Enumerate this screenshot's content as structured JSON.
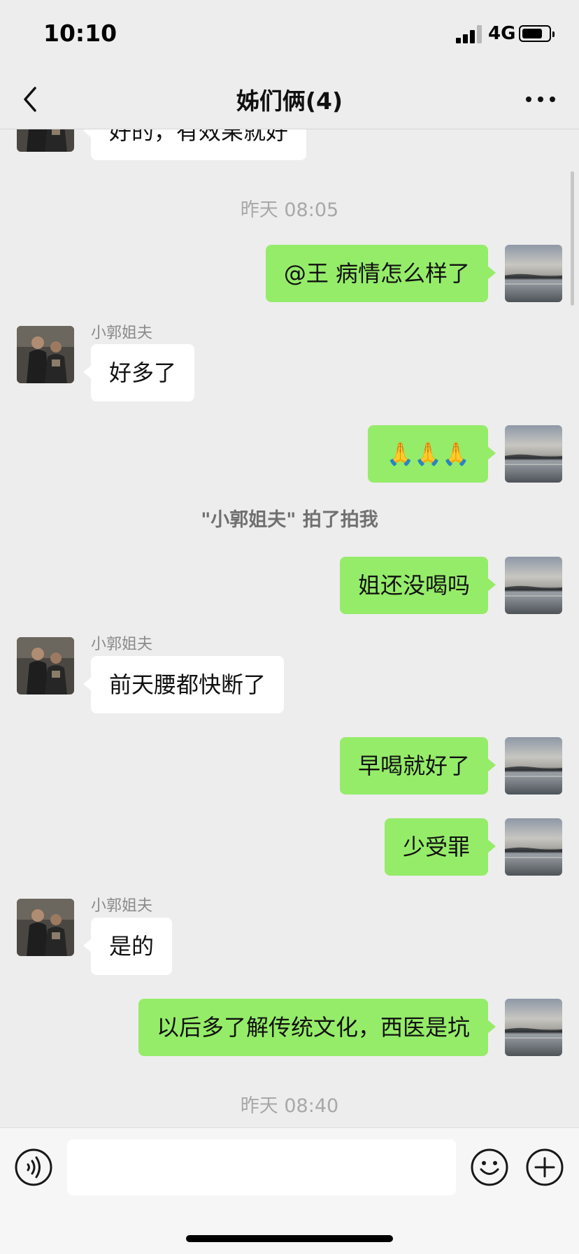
{
  "status_bar": {
    "time": "10:10",
    "network": "4G"
  },
  "nav": {
    "title": "姊们俩(4)"
  },
  "messages": {
    "partial": "好的，有效果就好",
    "ts1": "昨天 08:05",
    "m1": "@王 病情怎么样了",
    "s1": "小郭姐夫",
    "m2": "好多了",
    "m3": "🙏🙏🙏",
    "sys1": "\"小郭姐夫\" 拍了拍我",
    "m4": "姐还没喝吗",
    "s2": "小郭姐夫",
    "m5": "前天腰都快断了",
    "m6": "早喝就好了",
    "m7": "少受罪",
    "s3": "小郭姐夫",
    "m8": "是的",
    "m9": "以后多了解传统文化，西医是坑",
    "ts2": "昨天 08:40"
  },
  "input": {
    "value": "",
    "placeholder": ""
  },
  "colors": {
    "background": "#ededed",
    "outgoing_bubble": "#95ec69",
    "incoming_bubble": "#ffffff",
    "timestamp": "#a8a8a8"
  },
  "icons": {
    "back": "chevron-left-icon",
    "more": "more-dots-icon",
    "voice": "voice-icon",
    "emoji": "emoji-icon",
    "plus": "plus-icon"
  }
}
